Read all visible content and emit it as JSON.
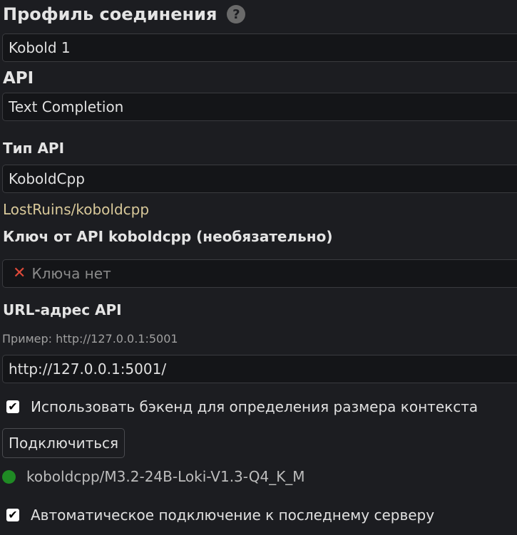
{
  "profile": {
    "title": "Профиль соединения",
    "help_glyph": "?",
    "value": "Kobold 1"
  },
  "api": {
    "label": "API",
    "value": "Text Completion"
  },
  "api_type": {
    "label": "Тип API",
    "value": "KoboldCpp",
    "link_text": "LostRuins/koboldcpp"
  },
  "api_key": {
    "label": "Ключ от API koboldcpp (необязательно)",
    "status_glyph": "✕",
    "status_text": "Ключа нет"
  },
  "url": {
    "label": "URL-адрес API",
    "hint": "Пример: http://127.0.0.1:5001",
    "value": "http://127.0.0.1:5001/"
  },
  "options": {
    "use_backend_context": {
      "checked": true,
      "label": "Использовать бэкенд для определения размера контекста"
    },
    "auto_connect": {
      "checked": true,
      "label": "Автоматическое подключение к последнему серверу"
    }
  },
  "connect_button": "Подключиться",
  "status": {
    "model": "koboldcpp/M3.2-24B-Loki-V1.3-Q4_K_M",
    "color": "#1f8a24"
  },
  "colors": {
    "background": "#1c1d21",
    "field": "#141518",
    "link": "#d9c99a",
    "error": "#e04a3a"
  }
}
